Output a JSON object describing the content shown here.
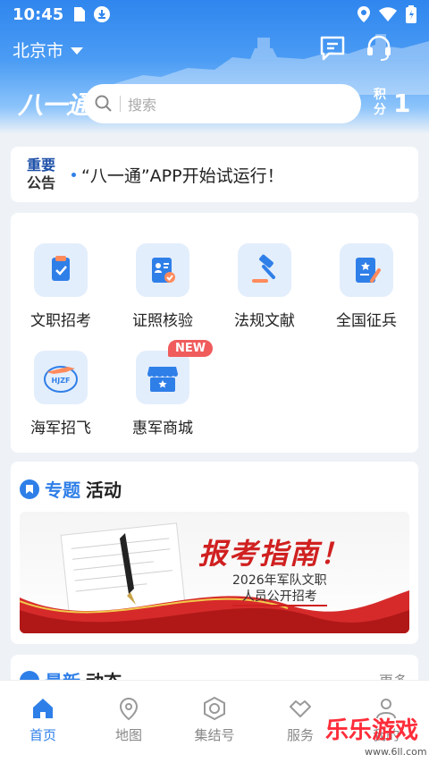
{
  "status_bar": {
    "time": "10:45"
  },
  "header": {
    "city": "北京市",
    "logo_text": "八一通",
    "search_placeholder": "搜索",
    "points_label": "积分",
    "points_value": "1"
  },
  "notice": {
    "badge_top": "重要",
    "badge_bottom": "公告",
    "text": "“八一通”APP开始试运行！"
  },
  "services": [
    {
      "label": "文职招考",
      "icon": "exam-icon"
    },
    {
      "label": "证照核验",
      "icon": "id-verify-icon"
    },
    {
      "label": "法规文献",
      "icon": "gavel-icon"
    },
    {
      "label": "全国征兵",
      "icon": "recruit-doc-icon"
    },
    {
      "label": "海军招飞",
      "icon": "navy-jet-icon"
    },
    {
      "label": "惠军商城",
      "icon": "shop-icon",
      "badge": "NEW"
    }
  ],
  "topic": {
    "title_blue": "专题",
    "title_rest": "活动",
    "banner_title": "报考指南！",
    "banner_line1": "2026年军队文职",
    "banner_line2": "人员公开招考"
  },
  "latest": {
    "title_blue": "最新",
    "title_rest": "动态",
    "more": "更多"
  },
  "bottom_nav": [
    {
      "label": "首页",
      "active": true
    },
    {
      "label": "地图",
      "active": false
    },
    {
      "label": "集结号",
      "active": false
    },
    {
      "label": "服务",
      "active": false
    },
    {
      "label": "我的",
      "active": false
    }
  ],
  "watermark": {
    "text": "乐乐游戏",
    "sub": "www.6ll.com"
  },
  "colors": {
    "accent": "#2f7fe8",
    "header_blue": "#2f86ee",
    "banner_red": "#d02020",
    "badge_red": "#f05c5c"
  }
}
